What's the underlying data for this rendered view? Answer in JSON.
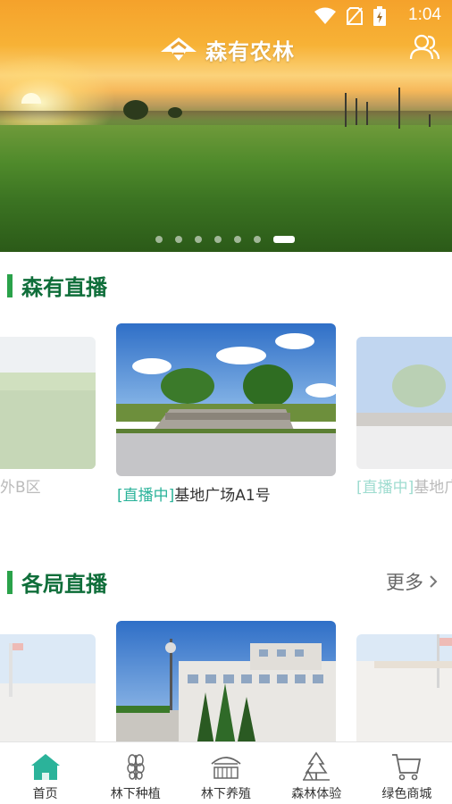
{
  "status": {
    "time": "1:04"
  },
  "header": {
    "app_title": "森有农林"
  },
  "banner": {
    "active_slide": 7,
    "total_slides": 7
  },
  "sections": {
    "live": {
      "title": "森有直播",
      "cards": [
        {
          "caption": "外B区"
        },
        {
          "live_tag": "[直播中]",
          "caption": "基地广场A1号"
        },
        {
          "live_tag": "[直播中]",
          "caption": "基地广"
        }
      ]
    },
    "bureau": {
      "title": "各局直播",
      "more_label": "更多"
    }
  },
  "bottom_nav": [
    {
      "label": "首页",
      "icon": "home-icon",
      "active": true
    },
    {
      "label": "林下种植",
      "icon": "plant-icon"
    },
    {
      "label": "林下养殖",
      "icon": "farm-shed-icon"
    },
    {
      "label": "森林体验",
      "icon": "forest-tree-icon"
    },
    {
      "label": "绿色商城",
      "icon": "cart-icon"
    }
  ],
  "colors": {
    "accent_green": "#2aa24a",
    "title_green": "#0f6e3a",
    "live_tag": "#2bb39a",
    "home_active": "#2bb39a"
  }
}
